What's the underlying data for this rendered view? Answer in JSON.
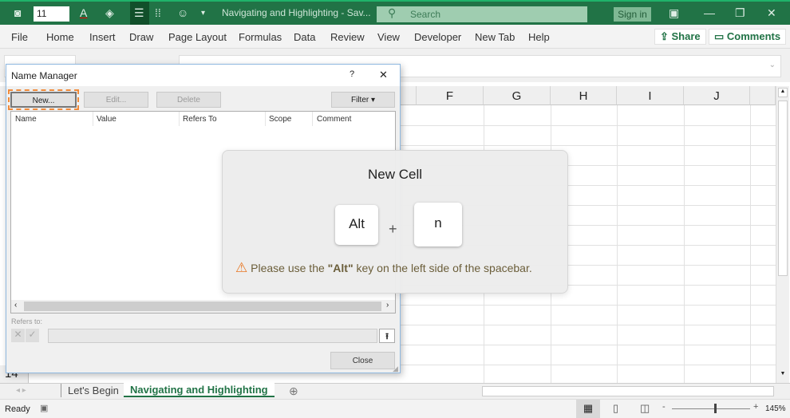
{
  "titlebar": {
    "font_size": "11",
    "doc_title": "Navigating and Highlighting  -  Sav...",
    "search_placeholder": "Search",
    "sign_in": "Sign in"
  },
  "ribbon": {
    "tabs": [
      "File",
      "Home",
      "Insert",
      "Draw",
      "Page Layout",
      "Formulas",
      "Data",
      "Review",
      "View",
      "Developer",
      "New Tab",
      "Help"
    ],
    "share": "Share",
    "comments": "Comments"
  },
  "grid": {
    "columns": [
      "F",
      "G",
      "H",
      "I",
      "J"
    ],
    "visible_row": "14"
  },
  "dialog": {
    "title": "Name Manager",
    "help": "?",
    "close_x": "✕",
    "new": "New...",
    "edit": "Edit...",
    "delete": "Delete",
    "filter": "Filter ▾",
    "headers": [
      "Name",
      "Value",
      "Refers To",
      "Scope",
      "Comment"
    ],
    "refers_to_label": "Refers to:",
    "close": "Close"
  },
  "overlay": {
    "title": "New Cell",
    "key1": "Alt",
    "plus": "+",
    "key2": "n",
    "warning_pre": "Please use the ",
    "warning_key": "\"Alt\"",
    "warning_post": " key on the left side of the spacebar."
  },
  "sheets": {
    "tabs": [
      "Let's Begin",
      "Navigating and Highlighting"
    ],
    "active": 1
  },
  "status": {
    "ready": "Ready",
    "zoom": "145%"
  },
  "colors": {
    "excel_green": "#217346",
    "warning": "#e87722"
  }
}
